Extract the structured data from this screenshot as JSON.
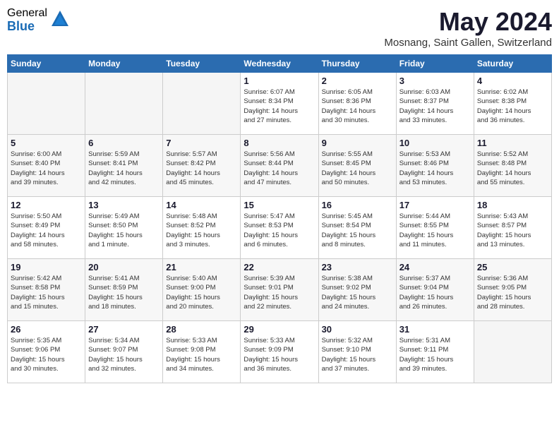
{
  "header": {
    "logo_general": "General",
    "logo_blue": "Blue",
    "title": "May 2024",
    "location": "Mosnang, Saint Gallen, Switzerland"
  },
  "weekdays": [
    "Sunday",
    "Monday",
    "Tuesday",
    "Wednesday",
    "Thursday",
    "Friday",
    "Saturday"
  ],
  "weeks": [
    [
      {
        "day": "",
        "info": ""
      },
      {
        "day": "",
        "info": ""
      },
      {
        "day": "",
        "info": ""
      },
      {
        "day": "1",
        "info": "Sunrise: 6:07 AM\nSunset: 8:34 PM\nDaylight: 14 hours\nand 27 minutes."
      },
      {
        "day": "2",
        "info": "Sunrise: 6:05 AM\nSunset: 8:36 PM\nDaylight: 14 hours\nand 30 minutes."
      },
      {
        "day": "3",
        "info": "Sunrise: 6:03 AM\nSunset: 8:37 PM\nDaylight: 14 hours\nand 33 minutes."
      },
      {
        "day": "4",
        "info": "Sunrise: 6:02 AM\nSunset: 8:38 PM\nDaylight: 14 hours\nand 36 minutes."
      }
    ],
    [
      {
        "day": "5",
        "info": "Sunrise: 6:00 AM\nSunset: 8:40 PM\nDaylight: 14 hours\nand 39 minutes."
      },
      {
        "day": "6",
        "info": "Sunrise: 5:59 AM\nSunset: 8:41 PM\nDaylight: 14 hours\nand 42 minutes."
      },
      {
        "day": "7",
        "info": "Sunrise: 5:57 AM\nSunset: 8:42 PM\nDaylight: 14 hours\nand 45 minutes."
      },
      {
        "day": "8",
        "info": "Sunrise: 5:56 AM\nSunset: 8:44 PM\nDaylight: 14 hours\nand 47 minutes."
      },
      {
        "day": "9",
        "info": "Sunrise: 5:55 AM\nSunset: 8:45 PM\nDaylight: 14 hours\nand 50 minutes."
      },
      {
        "day": "10",
        "info": "Sunrise: 5:53 AM\nSunset: 8:46 PM\nDaylight: 14 hours\nand 53 minutes."
      },
      {
        "day": "11",
        "info": "Sunrise: 5:52 AM\nSunset: 8:48 PM\nDaylight: 14 hours\nand 55 minutes."
      }
    ],
    [
      {
        "day": "12",
        "info": "Sunrise: 5:50 AM\nSunset: 8:49 PM\nDaylight: 14 hours\nand 58 minutes."
      },
      {
        "day": "13",
        "info": "Sunrise: 5:49 AM\nSunset: 8:50 PM\nDaylight: 15 hours\nand 1 minute."
      },
      {
        "day": "14",
        "info": "Sunrise: 5:48 AM\nSunset: 8:52 PM\nDaylight: 15 hours\nand 3 minutes."
      },
      {
        "day": "15",
        "info": "Sunrise: 5:47 AM\nSunset: 8:53 PM\nDaylight: 15 hours\nand 6 minutes."
      },
      {
        "day": "16",
        "info": "Sunrise: 5:45 AM\nSunset: 8:54 PM\nDaylight: 15 hours\nand 8 minutes."
      },
      {
        "day": "17",
        "info": "Sunrise: 5:44 AM\nSunset: 8:55 PM\nDaylight: 15 hours\nand 11 minutes."
      },
      {
        "day": "18",
        "info": "Sunrise: 5:43 AM\nSunset: 8:57 PM\nDaylight: 15 hours\nand 13 minutes."
      }
    ],
    [
      {
        "day": "19",
        "info": "Sunrise: 5:42 AM\nSunset: 8:58 PM\nDaylight: 15 hours\nand 15 minutes."
      },
      {
        "day": "20",
        "info": "Sunrise: 5:41 AM\nSunset: 8:59 PM\nDaylight: 15 hours\nand 18 minutes."
      },
      {
        "day": "21",
        "info": "Sunrise: 5:40 AM\nSunset: 9:00 PM\nDaylight: 15 hours\nand 20 minutes."
      },
      {
        "day": "22",
        "info": "Sunrise: 5:39 AM\nSunset: 9:01 PM\nDaylight: 15 hours\nand 22 minutes."
      },
      {
        "day": "23",
        "info": "Sunrise: 5:38 AM\nSunset: 9:02 PM\nDaylight: 15 hours\nand 24 minutes."
      },
      {
        "day": "24",
        "info": "Sunrise: 5:37 AM\nSunset: 9:04 PM\nDaylight: 15 hours\nand 26 minutes."
      },
      {
        "day": "25",
        "info": "Sunrise: 5:36 AM\nSunset: 9:05 PM\nDaylight: 15 hours\nand 28 minutes."
      }
    ],
    [
      {
        "day": "26",
        "info": "Sunrise: 5:35 AM\nSunset: 9:06 PM\nDaylight: 15 hours\nand 30 minutes."
      },
      {
        "day": "27",
        "info": "Sunrise: 5:34 AM\nSunset: 9:07 PM\nDaylight: 15 hours\nand 32 minutes."
      },
      {
        "day": "28",
        "info": "Sunrise: 5:33 AM\nSunset: 9:08 PM\nDaylight: 15 hours\nand 34 minutes."
      },
      {
        "day": "29",
        "info": "Sunrise: 5:33 AM\nSunset: 9:09 PM\nDaylight: 15 hours\nand 36 minutes."
      },
      {
        "day": "30",
        "info": "Sunrise: 5:32 AM\nSunset: 9:10 PM\nDaylight: 15 hours\nand 37 minutes."
      },
      {
        "day": "31",
        "info": "Sunrise: 5:31 AM\nSunset: 9:11 PM\nDaylight: 15 hours\nand 39 minutes."
      },
      {
        "day": "",
        "info": ""
      }
    ]
  ]
}
